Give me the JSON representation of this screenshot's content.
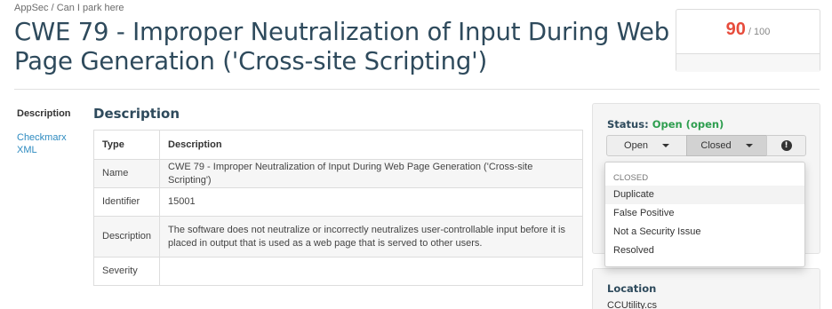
{
  "breadcrumb": "AppSec / Can I park here",
  "title": "CWE 79 - Improper Neutralization of Input During Web Page Generation ('Cross-site Scripting')",
  "score": {
    "value": "90",
    "max": "/ 100",
    "color": "#e74c3c"
  },
  "sidebar": {
    "heading": "Description",
    "links": [
      "Checkmarx",
      "XML"
    ]
  },
  "section_title": "Description",
  "table": {
    "headers": [
      "Type",
      "Description"
    ],
    "rows": [
      [
        "Name",
        "CWE 79 - Improper Neutralization of Input During Web Page Generation ('Cross-site Scripting')"
      ],
      [
        "Identifier",
        "15001"
      ],
      [
        "Description",
        "The software does not neutralize or incorrectly neutralizes user-controllable input before it is placed in output that is used as a web page that is served to other users."
      ],
      [
        "Severity",
        ""
      ]
    ]
  },
  "status": {
    "label": "Status:",
    "value": "Open (open)",
    "value_color": "#2e9e4f",
    "open_button": "Open",
    "closed_button": "Closed",
    "info_icon": "exclamation-circle-icon",
    "dropdown": {
      "header": "CLOSED",
      "items": [
        "Duplicate",
        "False Positive",
        "Not a Security Issue",
        "Resolved"
      ]
    }
  },
  "location": {
    "title": "Location",
    "file": "CCUtility.cs"
  }
}
